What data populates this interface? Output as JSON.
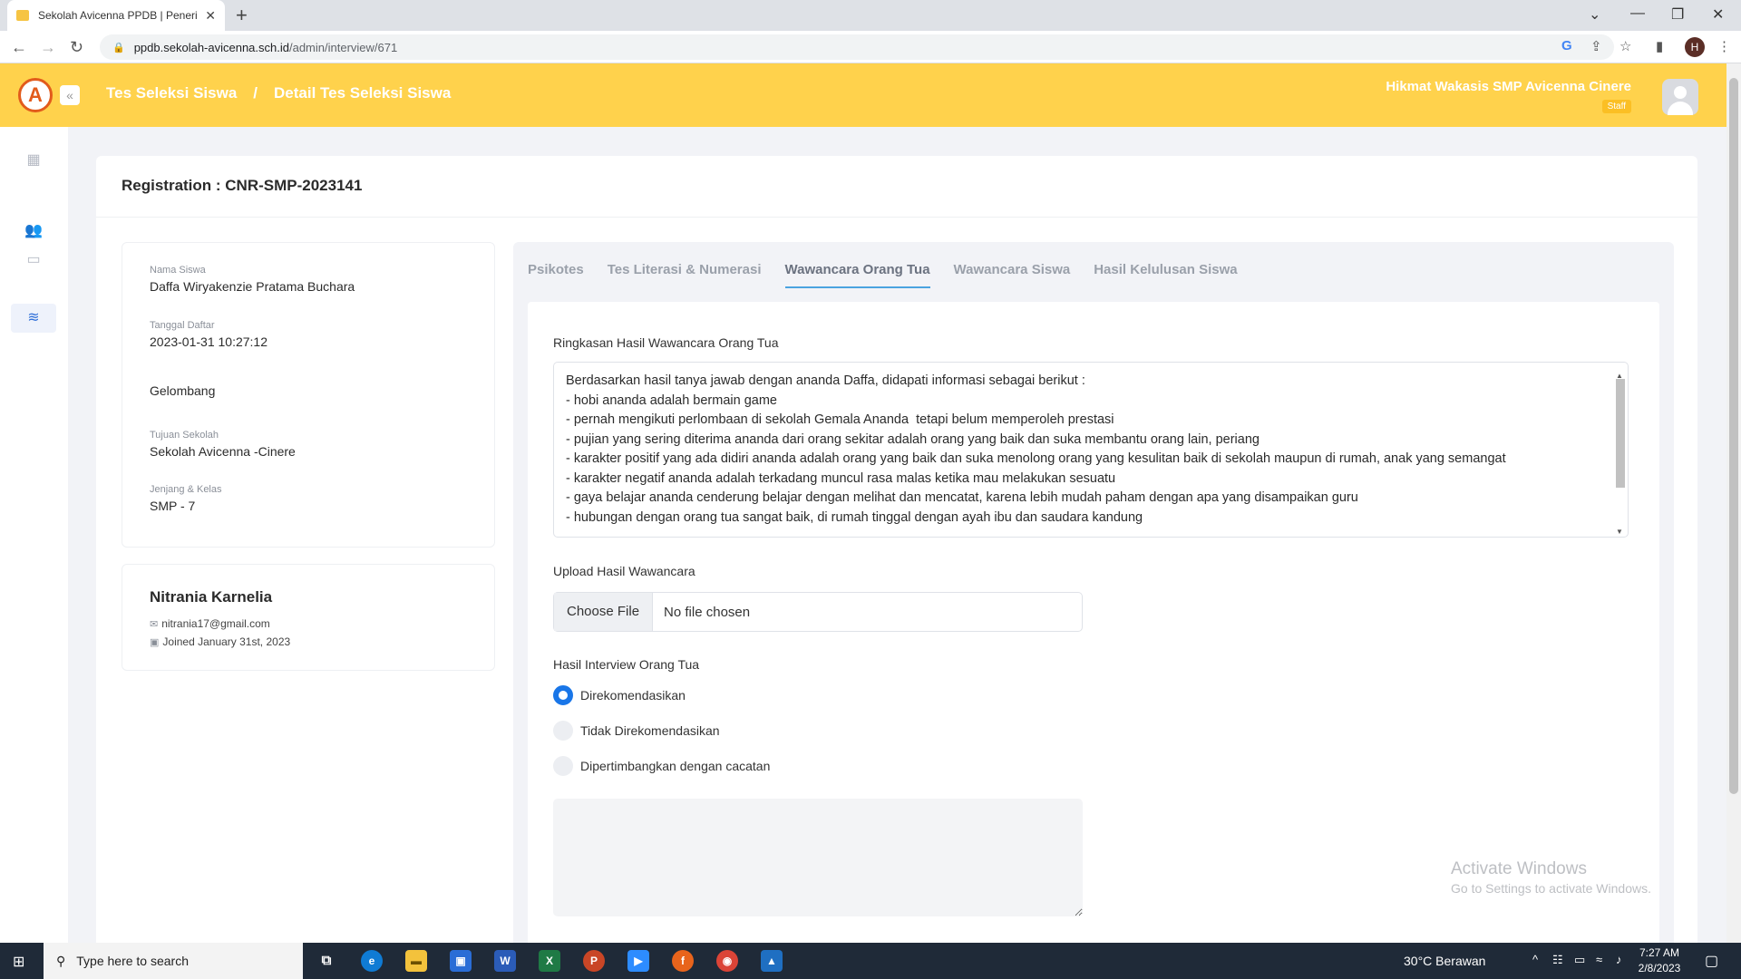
{
  "browser": {
    "tab_title": "Sekolah Avicenna PPDB | Penerimaan",
    "url_host": "ppdb.sekolah-avicenna.sch.id",
    "url_path": "/admin/interview/671",
    "profile_initial": "H"
  },
  "header": {
    "breadcrumb_root": "Tes Seleksi Siswa",
    "breadcrumb_sep": "/",
    "breadcrumb_current": "Detail Tes Seleksi Siswa",
    "user_name": "Hikmat Wakasis SMP Avicenna Cinere",
    "user_role": "Staff",
    "brand_color": "#ffd24c"
  },
  "registration": {
    "title": "Registration : CNR-SMP-2023141"
  },
  "student": {
    "name_label": "Nama Siswa",
    "name_value": "Daffa Wiryakenzie Pratama Buchara",
    "date_label": "Tanggal Daftar",
    "date_value": "2023-01-31 10:27:12",
    "wave_label": "Gelombang",
    "school_label": "Tujuan Sekolah",
    "school_value": "Sekolah Avicenna -Cinere",
    "grade_label": "Jenjang & Kelas",
    "grade_value": "SMP - 7"
  },
  "contact": {
    "name": "Nitrania Karnelia",
    "email": "nitrania17@gmail.com",
    "joined": "Joined January 31st, 2023"
  },
  "tabs": [
    {
      "label": "Psikotes",
      "active": false
    },
    {
      "label": "Tes Literasi & Numerasi",
      "active": false
    },
    {
      "label": "Wawancara Orang Tua",
      "active": true
    },
    {
      "label": "Wawancara Siswa",
      "active": false
    },
    {
      "label": "Hasil Kelulusan Siswa",
      "active": false
    }
  ],
  "form": {
    "summary_label": "Ringkasan Hasil Wawancara Orang Tua",
    "summary_text": "Berdasarkan hasil tanya jawab dengan ananda Daffa, didapati informasi sebagai berikut :\n- hobi ananda adalah bermain game\n- pernah mengikuti perlombaan di sekolah Gemala Ananda  tetapi belum memperoleh prestasi\n- pujian yang sering diterima ananda dari orang sekitar adalah orang yang baik dan suka membantu orang lain, periang\n- karakter positif yang ada didiri ananda adalah orang yang baik dan suka menolong orang yang kesulitan baik di sekolah maupun di rumah, anak yang semangat\n- karakter negatif ananda adalah terkadang muncul rasa malas ketika mau melakukan sesuatu\n- gaya belajar ananda cenderung belajar dengan melihat dan mencatat, karena lebih mudah paham dengan apa yang disampaikan guru\n- hubungan dengan orang tua sangat baik, di rumah tinggal dengan ayah ibu dan saudara kandung",
    "upload_label": "Upload Hasil Wawancara",
    "file_button": "Choose File",
    "file_status": "No file chosen",
    "result_label": "Hasil Interview Orang Tua",
    "options": [
      {
        "label": "Direkomendasikan",
        "checked": true
      },
      {
        "label": "Tidak Direkomendasikan",
        "checked": false
      },
      {
        "label": "Dipertimbangkan dengan cacatan",
        "checked": false
      }
    ],
    "notes_value": ""
  },
  "watermark": {
    "line1": "Activate Windows",
    "line2": "Go to Settings to activate Windows."
  },
  "taskbar": {
    "search_placeholder": "Type here to search",
    "weather": "30°C  Berawan",
    "time": "7:27 AM",
    "date": "2/8/2023"
  }
}
